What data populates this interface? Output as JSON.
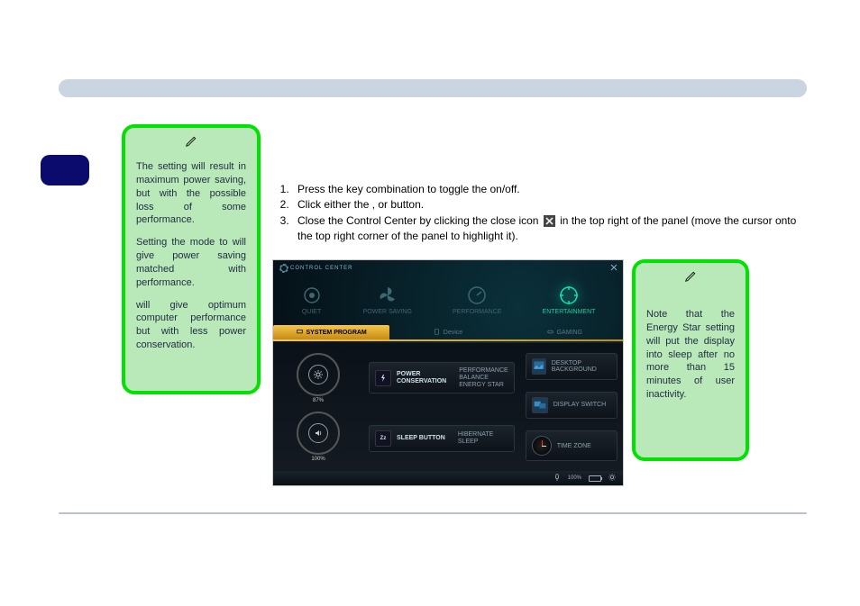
{
  "leftCallout": {
    "p1_a": "The ",
    "p1_b": " setting will result in maximum power saving, but with the possible loss of some performance.",
    "p2_a": "Setting the mode to ",
    "p2_b": " will give power saving matched with performance.",
    "p3_a": "",
    "p3_b": " will give optimum computer performance but with less power conservation."
  },
  "rightCallout": {
    "p1": "Note that the Energy Star setting will put the display into sleep after no more than 15 minutes of user inactivity."
  },
  "instructions": {
    "i1_a": "Press the ",
    "i1_b": " key combination to toggle the ",
    "i1_c": " on/off.",
    "i2_a": "Click either the ",
    "i2_b": ", ",
    "i2_c": " or ",
    "i2_d": " button.",
    "i3_a": "Close the Control Center by clicking the close icon ",
    "i3_b": " in the top right of the panel (move the cursor onto the top right corner of the panel to highlight it)."
  },
  "cc": {
    "title": "CONTROL CENTER",
    "modes": [
      "QUIET",
      "POWER SAVING",
      "PERFORMANCE",
      "ENTERTAINMENT"
    ],
    "tabs": [
      "SYSTEM PROGRAM",
      "Device",
      "GAMING"
    ],
    "dial1": "87%",
    "dial2": "100%",
    "power_title": "POWER",
    "power_sub": "CONSERVATION",
    "power_opts": [
      "PERFORMANCE",
      "BALANCE",
      "ENERGY STAR"
    ],
    "sleep_title": "SLEEP BUTTON",
    "sleep_opts": [
      "HIBERNATE",
      "SLEEP"
    ],
    "desktop_bg": "DESKTOP BACKGROUND",
    "display_switch": "DISPLAY SWITCH",
    "time_zone": "TIME ZONE",
    "footer_pct": "100%"
  }
}
